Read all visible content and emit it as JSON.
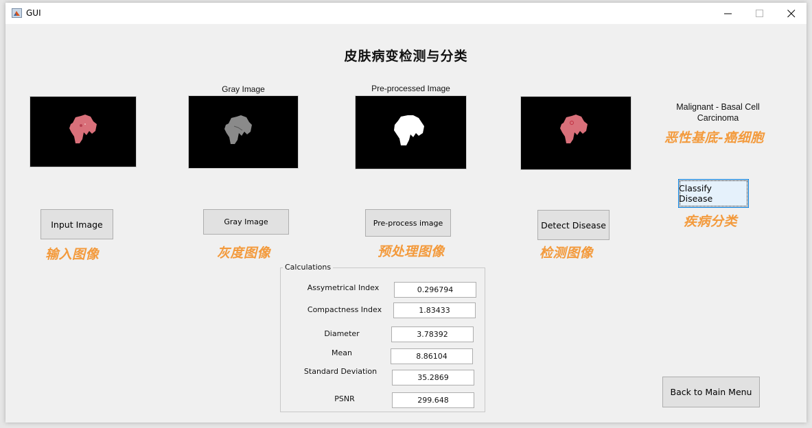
{
  "window": {
    "title": "GUI",
    "controls": {
      "minimize": "minimize",
      "maximize": "maximize",
      "close": "close"
    }
  },
  "main_title": "皮肤病变检测与分类",
  "axes": [
    {
      "id": "input",
      "title": "",
      "content": "lesion-color"
    },
    {
      "id": "gray",
      "title": "Gray Image",
      "content": "lesion-gray"
    },
    {
      "id": "preprocessed",
      "title": "Pre-processed Image",
      "content": "lesion-binary"
    },
    {
      "id": "detected",
      "title": "",
      "content": "lesion-color"
    }
  ],
  "buttons": {
    "input_image": "Input Image",
    "gray_image": "Gray Image",
    "preprocess_image": "Pre-process image",
    "detect_disease": "Detect Disease",
    "classify_disease": "Classify Disease",
    "back_to_main_menu": "Back to Main Menu"
  },
  "cn_labels": {
    "input_image": "输入图像",
    "gray_image": "灰度图像",
    "preprocess_image": "预处理图像",
    "detect_image": "检测图像",
    "classify": "疾病分类",
    "result": "恶性基底-癌细胞"
  },
  "result": {
    "line1": "Malignant - Basal Cell",
    "line2": "Carcinoma"
  },
  "calculations": {
    "title": "Calculations",
    "rows": [
      {
        "label": "Assymetrical Index",
        "value": "0.296794"
      },
      {
        "label": "Compactness Index",
        "value": "1.83433"
      },
      {
        "label": "Diameter",
        "value": "3.78392"
      },
      {
        "label": "Mean",
        "value": "8.86104"
      },
      {
        "label": "Standard Deviation",
        "value": "35.2869"
      },
      {
        "label": "PSNR",
        "value": "299.648"
      }
    ]
  },
  "colors": {
    "cn_label": "#f39a3c",
    "lesion_color": "#d9707a",
    "lesion_gray": "#8a8a8a",
    "lesion_binary": "#ffffff"
  }
}
